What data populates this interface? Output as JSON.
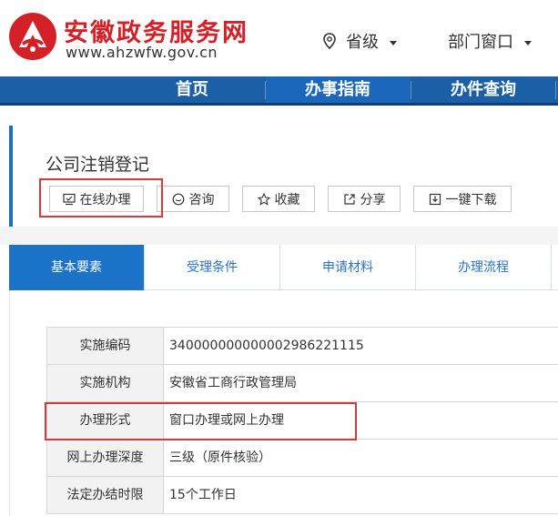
{
  "header": {
    "site_name": "安徽政务服务网",
    "site_url": "www.ahzwfw.gov.cn",
    "region_label": "省级",
    "department_label": "部门窗口",
    "colors": {
      "brand_red": "#d42127",
      "nav_blue": "#1b5fa6"
    }
  },
  "nav": {
    "items": [
      {
        "label": "首页"
      },
      {
        "label": "办事指南"
      },
      {
        "label": "办件查询"
      }
    ],
    "active": "办事指南"
  },
  "service": {
    "title": "公司注销登记",
    "actions": [
      {
        "label": "在线办理",
        "icon": "monitor-icon"
      },
      {
        "label": "咨询",
        "icon": "chat-icon"
      },
      {
        "label": "收藏",
        "icon": "star-icon"
      },
      {
        "label": "分享",
        "icon": "share-icon"
      },
      {
        "label": "一键下载",
        "icon": "download-icon"
      }
    ]
  },
  "tabs": {
    "items": [
      {
        "label": "基本要素"
      },
      {
        "label": "受理条件"
      },
      {
        "label": "申请材料"
      },
      {
        "label": "办理流程"
      }
    ],
    "active": "基本要素"
  },
  "details": {
    "rows": [
      {
        "label": "实施编码",
        "value": "340000000000002986221115"
      },
      {
        "label": "实施机构",
        "value": "安徽省工商行政管理局"
      },
      {
        "label": "办理形式",
        "value": "窗口办理或网上办理"
      },
      {
        "label": "网上办理深度",
        "value": "三级（原件核验）"
      },
      {
        "label": "法定办结时限",
        "value": "15个工作日"
      }
    ]
  },
  "highlight_color": "#d9383a"
}
